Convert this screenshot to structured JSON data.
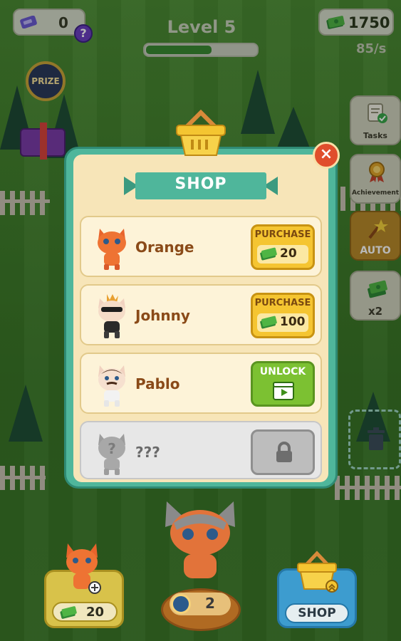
{
  "hud": {
    "gems": "0",
    "help": "?",
    "level_title": "Level 5",
    "level_progress": 0.6,
    "money": "1750",
    "rate": "85/s"
  },
  "left_items": {
    "prize_label": "PRIZE"
  },
  "side_buttons": [
    {
      "label": "Tasks",
      "icon": "tasks-icon"
    },
    {
      "label": "Achievement",
      "icon": "achievement-icon"
    },
    {
      "label": "AUTO",
      "icon": "auto-icon"
    },
    {
      "label": "x2",
      "icon": "money-stack-icon"
    }
  ],
  "shop": {
    "title": "SHOP",
    "close": "×",
    "items": [
      {
        "name": "Orange",
        "action": "PURCHASE",
        "cost": "20",
        "state": "purchase"
      },
      {
        "name": "Johnny",
        "action": "PURCHASE",
        "cost": "100",
        "state": "purchase"
      },
      {
        "name": "Pablo",
        "action": "UNLOCK",
        "state": "unlock"
      },
      {
        "name": "???",
        "state": "locked"
      }
    ]
  },
  "bottom": {
    "spawn_price": "20",
    "timer_value": "2",
    "shop_label": "SHOP"
  },
  "colors": {
    "modal_frame": "#4fb69b",
    "purchase_button": "#f5c531",
    "unlock_button": "#7cc132",
    "close_button": "#e04e2c",
    "shop_button": "#3d9ccf"
  }
}
